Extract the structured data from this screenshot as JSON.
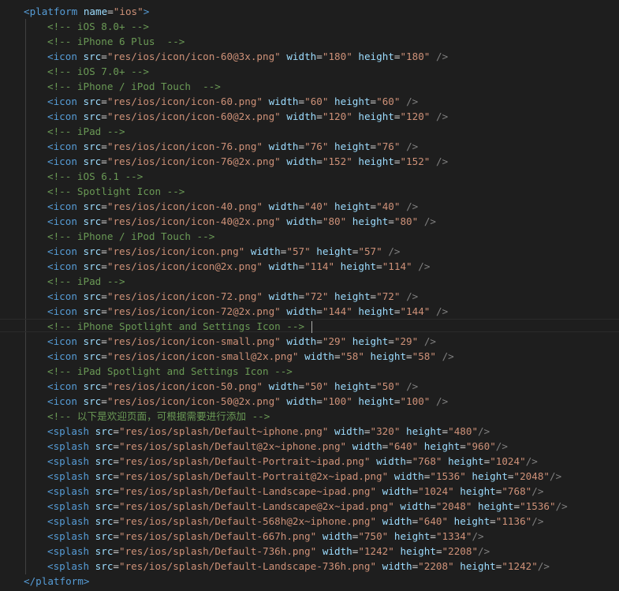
{
  "editor": {
    "colors": {
      "background": "#1e1e1e",
      "tag": "#569cd6",
      "attribute": "#9cdcfe",
      "value": "#ce9178",
      "comment": "#6a9955",
      "punctuation": "#808080"
    },
    "lines": [
      {
        "kind": "open",
        "text": "<platform name=\"ios\">"
      },
      {
        "kind": "comment",
        "text": "<!-- iOS 8.0+ -->"
      },
      {
        "kind": "comment",
        "text": "<!-- iPhone 6 Plus  -->"
      },
      {
        "kind": "icon",
        "src": "\"res/ios/icon/icon-60@3x.png\"",
        "width": "\"180\"",
        "height": "\"180\""
      },
      {
        "kind": "comment",
        "text": "<!-- iOS 7.0+ -->"
      },
      {
        "kind": "comment",
        "text": "<!-- iPhone / iPod Touch  -->"
      },
      {
        "kind": "icon",
        "src": "\"res/ios/icon/icon-60.png\"",
        "width": "\"60\"",
        "height": "\"60\""
      },
      {
        "kind": "icon",
        "src": "\"res/ios/icon/icon-60@2x.png\"",
        "width": "\"120\"",
        "height": "\"120\""
      },
      {
        "kind": "comment",
        "text": "<!-- iPad -->"
      },
      {
        "kind": "icon",
        "src": "\"res/ios/icon/icon-76.png\"",
        "width": "\"76\"",
        "height": "\"76\""
      },
      {
        "kind": "icon",
        "src": "\"res/ios/icon/icon-76@2x.png\"",
        "width": "\"152\"",
        "height": "\"152\""
      },
      {
        "kind": "comment",
        "text": "<!-- iOS 6.1 -->"
      },
      {
        "kind": "comment",
        "text": "<!-- Spotlight Icon -->"
      },
      {
        "kind": "icon",
        "src": "\"res/ios/icon/icon-40.png\"",
        "width": "\"40\"",
        "height": "\"40\""
      },
      {
        "kind": "icon",
        "src": "\"res/ios/icon/icon-40@2x.png\"",
        "width": "\"80\"",
        "height": "\"80\""
      },
      {
        "kind": "comment",
        "text": "<!-- iPhone / iPod Touch -->"
      },
      {
        "kind": "icon",
        "src": "\"res/ios/icon/icon.png\"",
        "width": "\"57\"",
        "height": "\"57\""
      },
      {
        "kind": "icon",
        "src": "\"res/ios/icon/icon@2x.png\"",
        "width": "\"114\"",
        "height": "\"114\""
      },
      {
        "kind": "comment",
        "text": "<!-- iPad -->"
      },
      {
        "kind": "icon",
        "src": "\"res/ios/icon/icon-72.png\"",
        "width": "\"72\"",
        "height": "\"72\""
      },
      {
        "kind": "icon",
        "src": "\"res/ios/icon/icon-72@2x.png\"",
        "width": "\"144\"",
        "height": "\"144\""
      },
      {
        "kind": "comment",
        "text": "<!-- iPhone Spotlight and Settings Icon -->",
        "cursor": true
      },
      {
        "kind": "icon",
        "src": "\"res/ios/icon/icon-small.png\"",
        "width": "\"29\"",
        "height": "\"29\""
      },
      {
        "kind": "icon",
        "src": "\"res/ios/icon/icon-small@2x.png\"",
        "width": "\"58\"",
        "height": "\"58\""
      },
      {
        "kind": "comment",
        "text": "<!-- iPad Spotlight and Settings Icon -->"
      },
      {
        "kind": "icon",
        "src": "\"res/ios/icon/icon-50.png\"",
        "width": "\"50\"",
        "height": "\"50\""
      },
      {
        "kind": "icon",
        "src": "\"res/ios/icon/icon-50@2x.png\"",
        "width": "\"100\"",
        "height": "\"100\""
      },
      {
        "kind": "comment",
        "text": "<!-- 以下是欢迎页面，可根据需要进行添加 -->"
      },
      {
        "kind": "splash",
        "src": "\"res/ios/splash/Default~iphone.png\"",
        "width": "\"320\"",
        "height": "\"480\""
      },
      {
        "kind": "splash",
        "src": "\"res/ios/splash/Default@2x~iphone.png\"",
        "width": "\"640\"",
        "height": "\"960\""
      },
      {
        "kind": "splash",
        "src": "\"res/ios/splash/Default-Portrait~ipad.png\"",
        "width": "\"768\"",
        "height": "\"1024\""
      },
      {
        "kind": "splash",
        "src": "\"res/ios/splash/Default-Portrait@2x~ipad.png\"",
        "width": "\"1536\"",
        "height": "\"2048\""
      },
      {
        "kind": "splash",
        "src": "\"res/ios/splash/Default-Landscape~ipad.png\"",
        "width": "\"1024\"",
        "height": "\"768\""
      },
      {
        "kind": "splash",
        "src": "\"res/ios/splash/Default-Landscape@2x~ipad.png\"",
        "width": "\"2048\"",
        "height": "\"1536\""
      },
      {
        "kind": "splash",
        "src": "\"res/ios/splash/Default-568h@2x~iphone.png\"",
        "width": "\"640\"",
        "height": "\"1136\""
      },
      {
        "kind": "splash",
        "src": "\"res/ios/splash/Default-667h.png\"",
        "width": "\"750\"",
        "height": "\"1334\""
      },
      {
        "kind": "splash",
        "src": "\"res/ios/splash/Default-736h.png\"",
        "width": "\"1242\"",
        "height": "\"2208\""
      },
      {
        "kind": "splash",
        "src": "\"res/ios/splash/Default-Landscape-736h.png\"",
        "width": "\"2208\"",
        "height": "\"1242\""
      },
      {
        "kind": "close",
        "text": "</platform>"
      }
    ],
    "tokens": {
      "icon_open": "<icon",
      "splash_open": "<splash",
      "src_attr": "src",
      "width_attr": "width",
      "height_attr": "height",
      "equals": "=",
      "self_close": "/>"
    }
  }
}
